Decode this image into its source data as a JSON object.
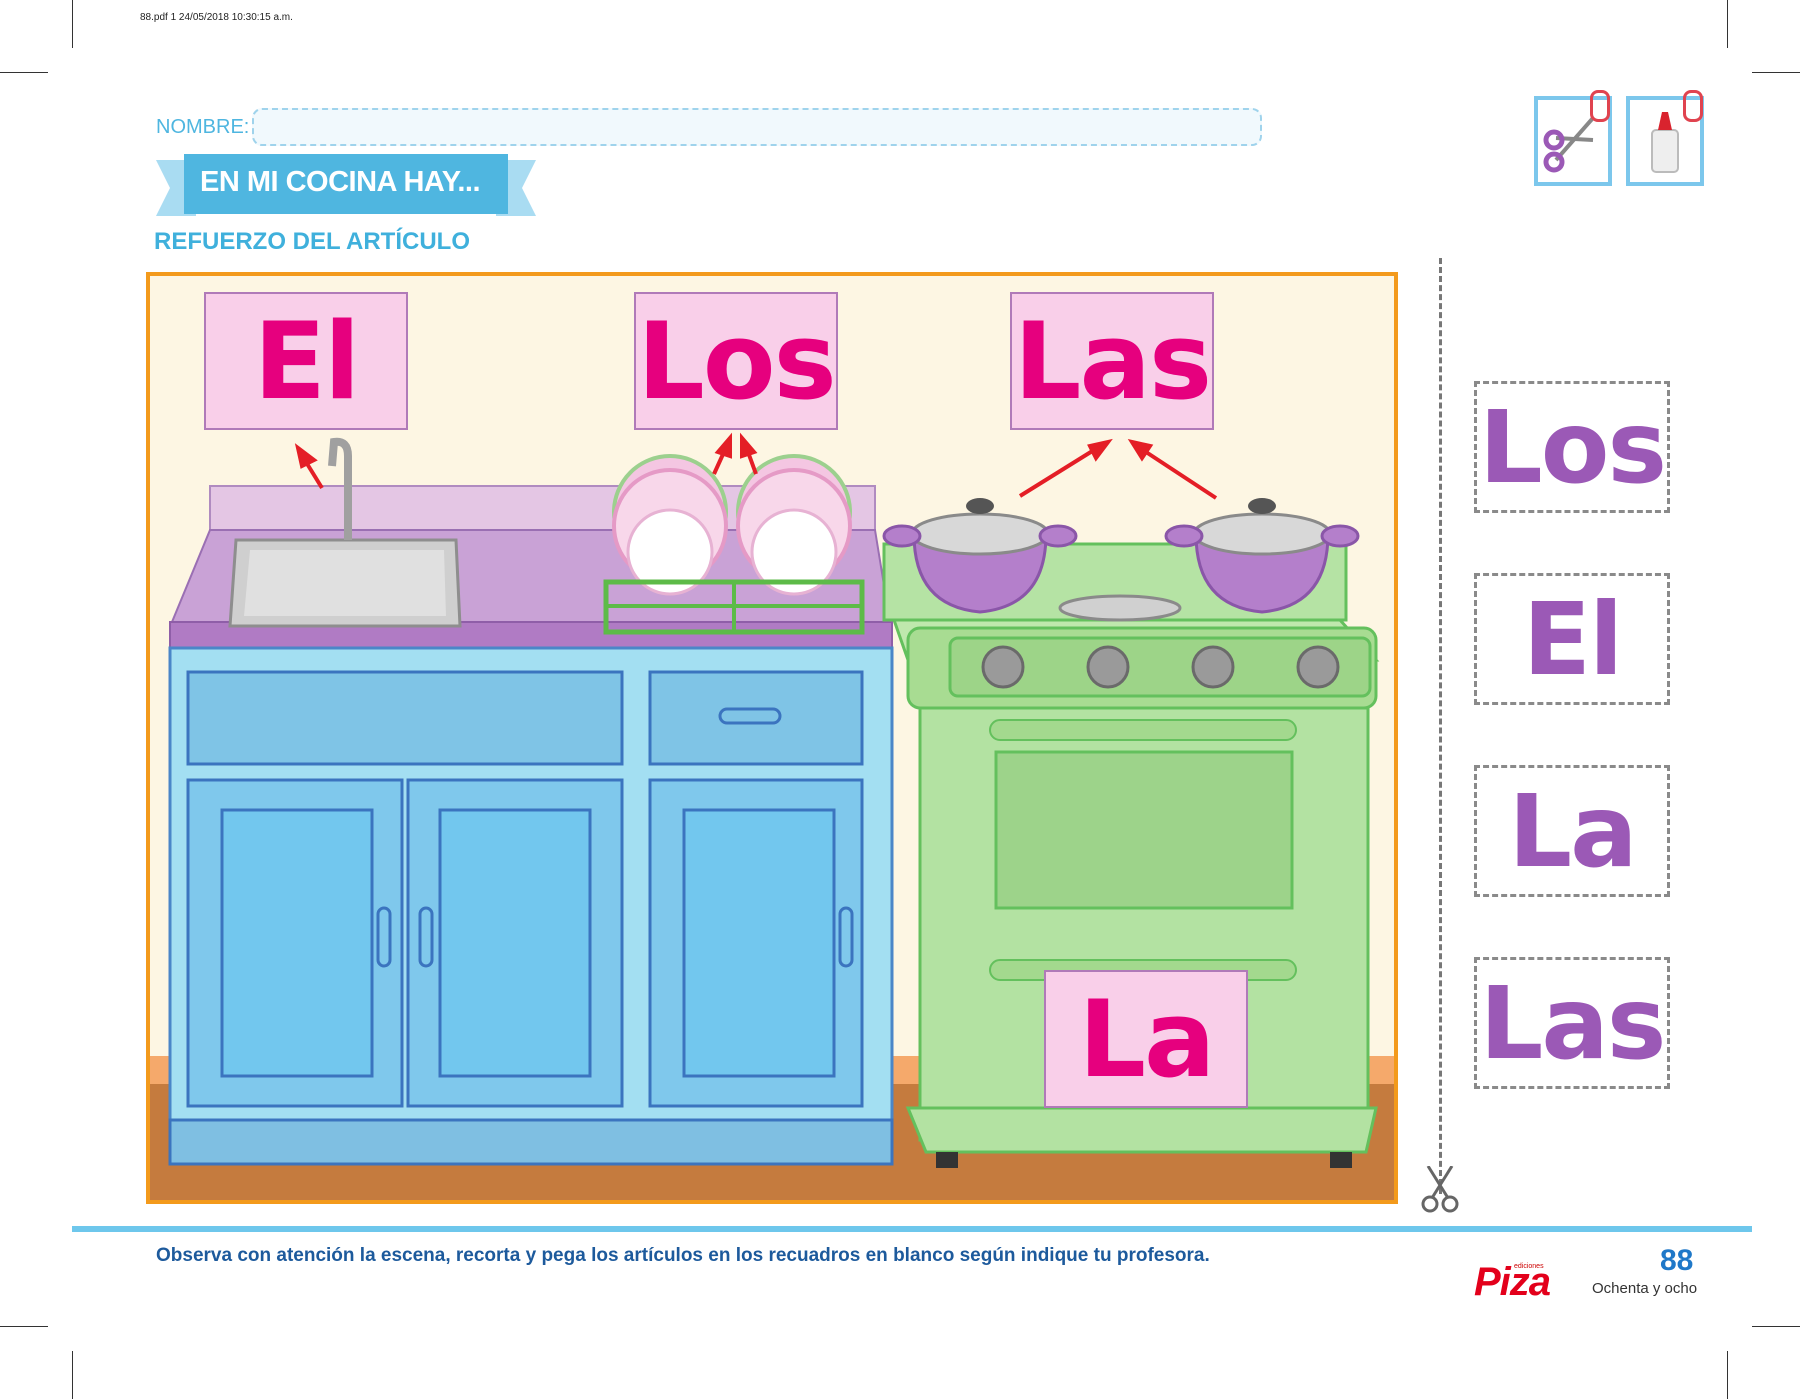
{
  "print_header": "88.pdf   1   24/05/2018   10:30:15 a.m.",
  "form": {
    "name_label": "NOMBRE:"
  },
  "title": "EN MI COCINA HAY...",
  "subtitle": "REFUERZO DEL ARTÍCULO",
  "tools": [
    {
      "icon": "scissors-icon"
    },
    {
      "icon": "glue-icon"
    }
  ],
  "scene_cards": [
    "El",
    "Los",
    "Las",
    "La"
  ],
  "cutout_cards": [
    "Los",
    "El",
    "La",
    "Las"
  ],
  "instruction": "Observa con atención la escena, recorta y pega los artículos en los recuadros en blanco según indique tu profesora.",
  "brand": {
    "small": "ediciones",
    "name": "Piza"
  },
  "page": {
    "number": "88",
    "words": "Ochenta y ocho"
  },
  "colors": {
    "accent_blue": "#4fb6e0",
    "card_pink": "#f9cfe9",
    "card_text": "#e6007e",
    "cutout_text": "#9b59b6",
    "frame_orange": "#f39a1c"
  }
}
